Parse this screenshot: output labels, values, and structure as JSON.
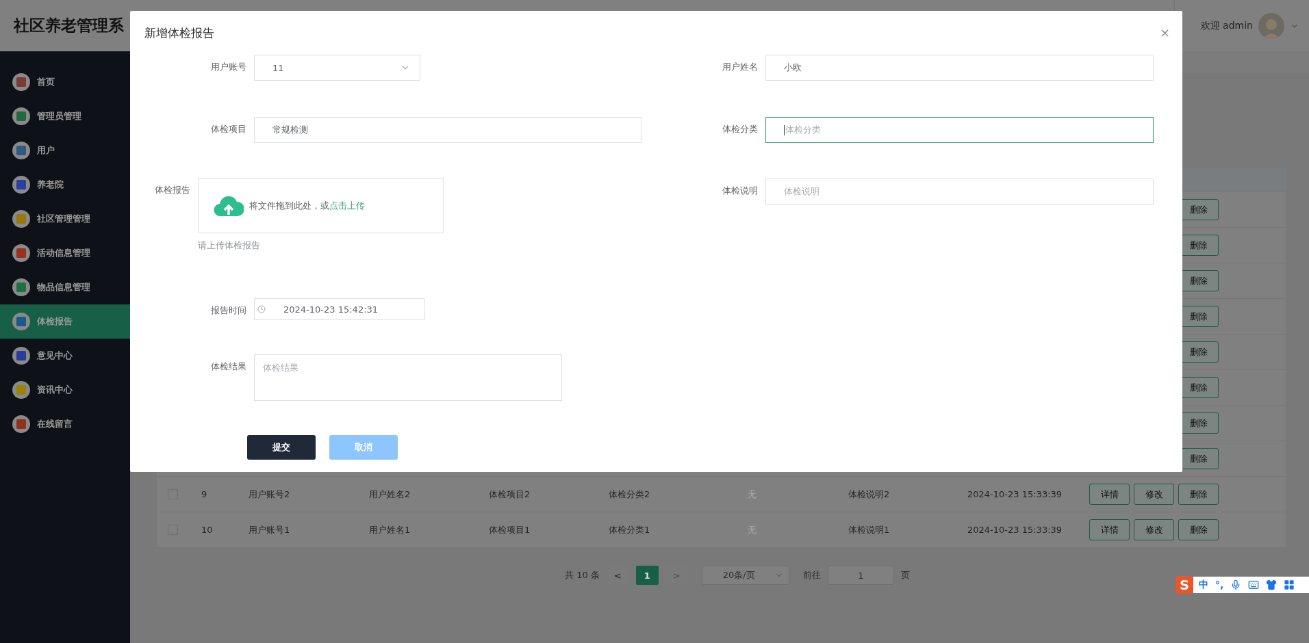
{
  "app": {
    "title": "社区养老管理系",
    "greeting": "欢迎 admin"
  },
  "sidebar": {
    "items": [
      {
        "label": "首页",
        "color": "#7a3a38",
        "selected": false
      },
      {
        "label": "管理员管理",
        "color": "#1f6a40",
        "selected": false
      },
      {
        "label": "用户",
        "color": "#34587e",
        "selected": false
      },
      {
        "label": "养老院",
        "color": "#2a40a0",
        "selected": false
      },
      {
        "label": "社区管理管理",
        "color": "#98780e",
        "selected": false
      },
      {
        "label": "活动信息管理",
        "color": "#9a3020",
        "selected": false
      },
      {
        "label": "物品信息管理",
        "color": "#1e7040",
        "selected": false
      },
      {
        "label": "体检报告",
        "color": "#1a5a86",
        "selected": true
      },
      {
        "label": "意见中心",
        "color": "#2a3c9a",
        "selected": false
      },
      {
        "label": "资讯中心",
        "color": "#98820a",
        "selected": false
      },
      {
        "label": "在线留言",
        "color": "#903020",
        "selected": false
      }
    ]
  },
  "table": {
    "rows": [
      {
        "actions": [
          "删除"
        ]
      },
      {
        "actions": [
          "删除"
        ]
      },
      {
        "actions": [
          "删除"
        ]
      },
      {
        "actions": [
          "删除"
        ]
      },
      {
        "actions": [
          "删除"
        ]
      },
      {
        "actions": [
          "删除"
        ]
      },
      {
        "actions": [
          "删除"
        ]
      },
      {
        "actions": [
          "删除"
        ]
      },
      {
        "checked": false,
        "cells": [
          "9",
          "用户账号2",
          "用户姓名2",
          "体检项目2",
          "体检分类2",
          "无",
          "体检说明2",
          "2024-10-23 15:33:39"
        ],
        "actions": [
          "详情",
          "修改",
          "删除"
        ]
      },
      {
        "checked": false,
        "cells": [
          "10",
          "用户账号1",
          "用户姓名1",
          "体检项目1",
          "体检分类1",
          "无",
          "体检说明1",
          "2024-10-23 15:33:39"
        ],
        "actions": [
          "详情",
          "修改",
          "删除"
        ]
      }
    ]
  },
  "pagination": {
    "total": "共 10 条",
    "prev": {
      "label": "<",
      "disabled": false
    },
    "pages": [
      {
        "label": "1",
        "selected": true
      }
    ],
    "next": {
      "label": ">",
      "disabled": true
    },
    "page_size": "20条/页",
    "goto_label": "前往",
    "goto_value": "1",
    "goto_suffix": "页"
  },
  "dialog": {
    "title": "新增体检报告",
    "close": "×",
    "left_fields": [
      {
        "kind": "select",
        "label": "用户账号",
        "value": "11",
        "focused": false
      },
      {
        "kind": "text",
        "label": "体检项目",
        "value": "常规检测",
        "focused": false
      },
      {
        "kind": "upload",
        "label": "体检报告",
        "drop_text": "将文件拖到此处，或",
        "link": "点击上传",
        "tip": "请上传体检报告"
      },
      {
        "kind": "datetime",
        "label": "报告时间",
        "value": "2024-10-23 15:42:31",
        "focused": false
      },
      {
        "kind": "textarea",
        "label": "体检结果",
        "placeholder": "体检结果",
        "focused": false
      }
    ],
    "right_fields": [
      {
        "kind": "text",
        "label": "用户姓名",
        "value": "小欧",
        "focused": false
      },
      {
        "kind": "text",
        "label": "体检分类",
        "placeholder": "体检分类",
        "focused": true
      },
      {
        "kind": "text",
        "label": "体检说明",
        "placeholder": "体检说明",
        "focused": false
      }
    ],
    "buttons": [
      {
        "label": "提交",
        "kind": "primary"
      },
      {
        "label": "取消",
        "kind": "secondary"
      }
    ]
  },
  "ime_toolbar": {
    "logo": "S",
    "mode": "中",
    "punct": "°,"
  }
}
